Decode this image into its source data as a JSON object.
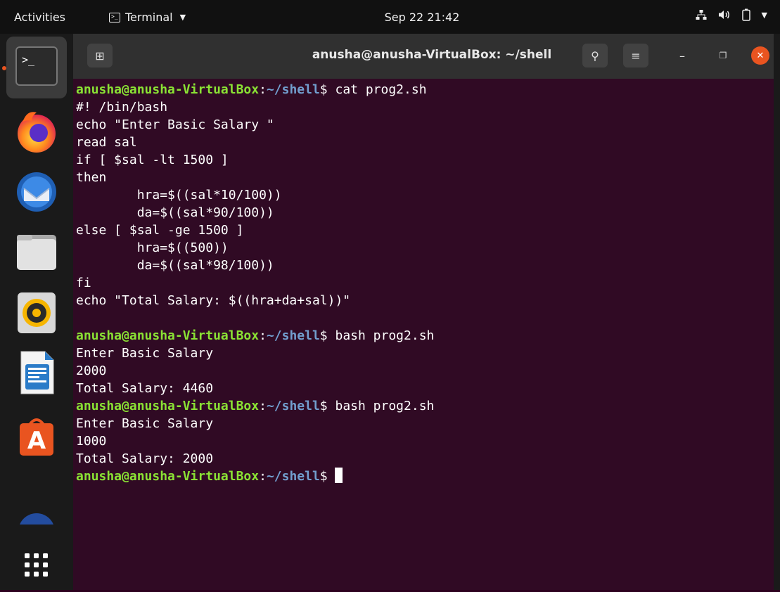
{
  "topbar": {
    "activities": "Activities",
    "app_name": "Terminal",
    "clock": "Sep 22  21:42"
  },
  "dock": {
    "items": [
      {
        "name": "terminal",
        "icon": "terminal-icon"
      },
      {
        "name": "firefox",
        "icon": "firefox-icon"
      },
      {
        "name": "thunderbird",
        "icon": "thunderbird-icon"
      },
      {
        "name": "files",
        "icon": "files-icon"
      },
      {
        "name": "rhythmbox",
        "icon": "rhythmbox-icon"
      },
      {
        "name": "writer",
        "icon": "libreoffice-writer-icon"
      },
      {
        "name": "software",
        "icon": "ubuntu-software-icon"
      },
      {
        "name": "help",
        "icon": "help-icon"
      },
      {
        "name": "show-apps",
        "icon": "grid-icon"
      }
    ],
    "terminal_glyph": ">_"
  },
  "window": {
    "title": "anusha@anusha-VirtualBox: ~/shell",
    "new_tab_glyph": "⊞",
    "search_glyph": "⚲",
    "menu_glyph": "≡",
    "minimize_glyph": "–",
    "maximize_glyph": "❐",
    "close_glyph": "✕"
  },
  "terminal": {
    "prompt_user": "anusha@anusha-VirtualBox",
    "prompt_sep": ":",
    "prompt_path": "~/shell",
    "prompt_end": "$ ",
    "lines": [
      {
        "type": "prompt",
        "cmd": "cat prog2.sh"
      },
      {
        "type": "out",
        "text": "#! /bin/bash"
      },
      {
        "type": "out",
        "text": "echo \"Enter Basic Salary \""
      },
      {
        "type": "out",
        "text": "read sal"
      },
      {
        "type": "out",
        "text": "if [ $sal -lt 1500 ]"
      },
      {
        "type": "out",
        "text": "then"
      },
      {
        "type": "out",
        "text": "        hra=$((sal*10/100))"
      },
      {
        "type": "out",
        "text": "        da=$((sal*90/100))"
      },
      {
        "type": "out",
        "text": "else [ $sal -ge 1500 ]"
      },
      {
        "type": "out",
        "text": "        hra=$((500))"
      },
      {
        "type": "out",
        "text": "        da=$((sal*98/100))"
      },
      {
        "type": "out",
        "text": "fi"
      },
      {
        "type": "out",
        "text": "echo \"Total Salary: $((hra+da+sal))\""
      },
      {
        "type": "out",
        "text": ""
      },
      {
        "type": "prompt",
        "cmd": "bash prog2.sh"
      },
      {
        "type": "out",
        "text": "Enter Basic Salary"
      },
      {
        "type": "out",
        "text": "2000"
      },
      {
        "type": "out",
        "text": "Total Salary: 4460"
      },
      {
        "type": "prompt",
        "cmd": "bash prog2.sh"
      },
      {
        "type": "out",
        "text": "Enter Basic Salary"
      },
      {
        "type": "out",
        "text": "1000"
      },
      {
        "type": "out",
        "text": "Total Salary: 2000"
      },
      {
        "type": "prompt",
        "cmd": "",
        "cursor": true
      }
    ]
  },
  "colors": {
    "terminal_bg": "#300a24",
    "prompt_user": "#8ae234",
    "prompt_path": "#729fcf",
    "close_button": "#e95420"
  }
}
